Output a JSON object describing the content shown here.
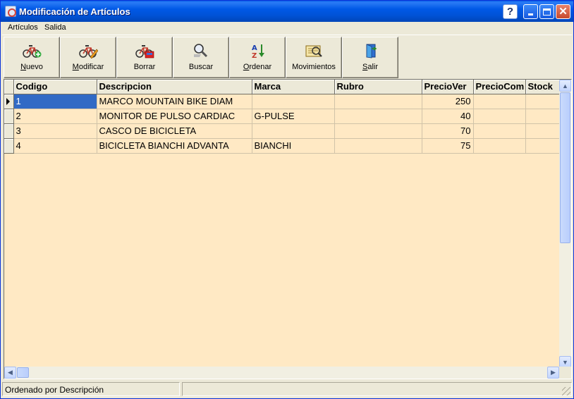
{
  "window": {
    "title": "Modificación de Artículos",
    "help_label": "?"
  },
  "menu": {
    "items": [
      {
        "label": "Artículos"
      },
      {
        "label": "Salida"
      }
    ]
  },
  "toolbar": {
    "buttons": [
      {
        "label_pre": "",
        "label_ul": "N",
        "label_post": "uevo",
        "icon": "bicycle-add-icon"
      },
      {
        "label_pre": "",
        "label_ul": "M",
        "label_post": "odificar",
        "icon": "bicycle-edit-icon"
      },
      {
        "label_pre": "Borrar",
        "label_ul": "",
        "label_post": "",
        "icon": "bicycle-delete-icon"
      },
      {
        "label_pre": "Buscar",
        "label_ul": "",
        "label_post": "",
        "icon": "magnifier-icon"
      },
      {
        "label_pre": "",
        "label_ul": "O",
        "label_post": "rdenar",
        "icon": "sort-az-icon"
      },
      {
        "label_pre": "Movimientos",
        "label_ul": "",
        "label_post": "",
        "icon": "movements-icon"
      },
      {
        "label_pre": "",
        "label_ul": "S",
        "label_post": "alir",
        "icon": "exit-door-icon"
      }
    ]
  },
  "grid": {
    "columns": [
      "Codigo",
      "Descripcion",
      "Marca",
      "Rubro",
      "PrecioVer",
      "PrecioCom",
      "Stock"
    ],
    "rows": [
      {
        "codigo": "1",
        "descripcion": "MARCO MOUNTAIN BIKE DIAM",
        "marca": "",
        "rubro": "",
        "precio_venta": "250",
        "precio_compra": "",
        "stock": ""
      },
      {
        "codigo": "2",
        "descripcion": "MONITOR DE PULSO CARDIAC",
        "marca": "G-PULSE",
        "rubro": "",
        "precio_venta": "40",
        "precio_compra": "",
        "stock": ""
      },
      {
        "codigo": "3",
        "descripcion": "CASCO DE BICICLETA",
        "marca": "",
        "rubro": "",
        "precio_venta": "70",
        "precio_compra": "",
        "stock": ""
      },
      {
        "codigo": "4",
        "descripcion": "BICICLETA BIANCHI ADVANTA",
        "marca": "BIANCHI",
        "rubro": "",
        "precio_venta": "75",
        "precio_compra": "",
        "stock": ""
      }
    ],
    "selected_row": 0
  },
  "status": {
    "panel1": "Ordenado por Descripción",
    "panel2": ""
  },
  "colors": {
    "titlebar": "#0058e6",
    "grid_background": "#ffe9c4",
    "selection": "#316ac5",
    "chrome": "#ece9d8"
  }
}
